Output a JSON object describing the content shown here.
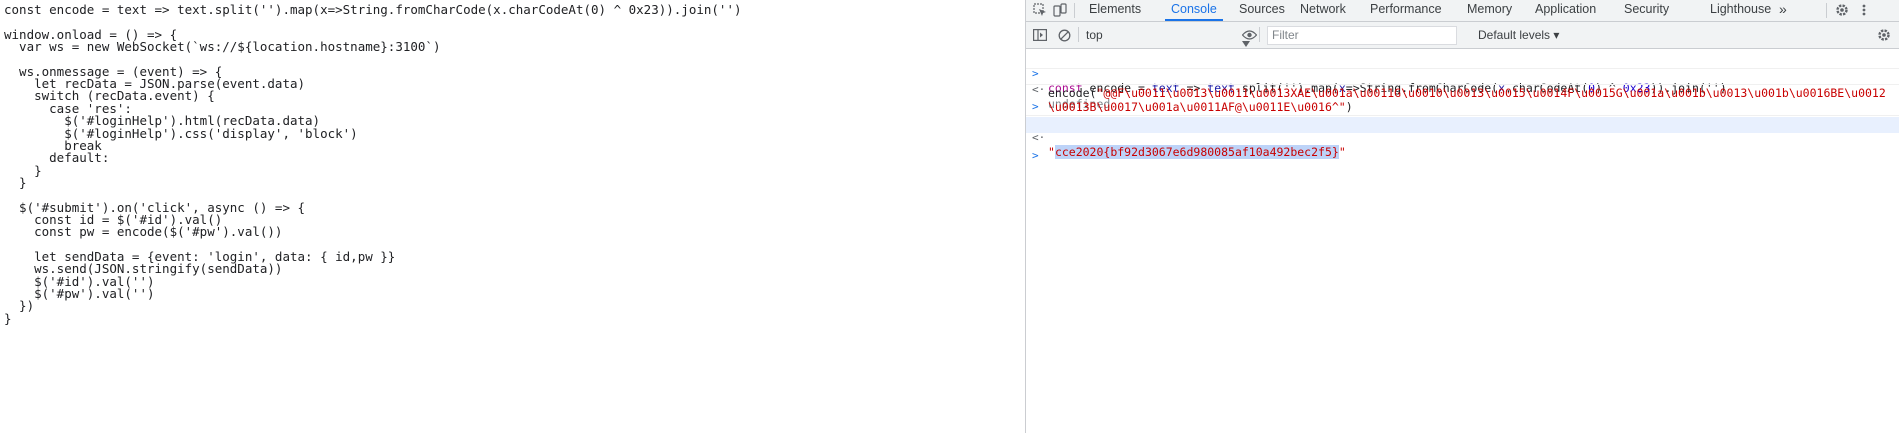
{
  "source": {
    "lines": [
      "const encode = text => text.split('').map(x=>String.fromCharCode(x.charCodeAt(0) ^ 0x23)).join('')",
      "",
      "window.onload = () => {",
      "  var ws = new WebSocket(`ws://${location.hostname}:3100`)",
      "",
      "  ws.onmessage = (event) => {",
      "    let recData = JSON.parse(event.data)",
      "    switch (recData.event) {",
      "      case 'res':",
      "        $('#loginHelp').html(recData.data)",
      "        $('#loginHelp').css('display', 'block')",
      "        break",
      "      default:",
      "    }",
      "  }",
      "",
      "  $('#submit').on('click', async () => {",
      "    const id = $('#id').val()",
      "    const pw = encode($('#pw').val())",
      "",
      "    let sendData = {event: 'login', data: { id,pw }}",
      "    ws.send(JSON.stringify(sendData))",
      "    $('#id').val('')",
      "    $('#pw').val('')",
      "  })",
      "}"
    ]
  },
  "devtools": {
    "tabs": [
      "Elements",
      "Console",
      "Sources",
      "Network",
      "Performance",
      "Memory",
      "Application",
      "Security",
      "Lighthouse"
    ],
    "active_tab": "Console",
    "more_tabs_glyph": "»",
    "toolbar": {
      "context": "top",
      "filter_placeholder": "Filter",
      "levels": "Default levels ▾"
    },
    "console": {
      "input1": {
        "prompt": ">",
        "p1": "const",
        "p2": " encode = ",
        "p3": "text",
        "p4": " => ",
        "p5": "text",
        "p6": ".split('').map(",
        "p7": "x",
        "p8": "=>String.fromCharCode(",
        "p9": "x",
        "p10": ".charCodeAt(",
        "p11": "0",
        "p12": ") ^ ",
        "p13": "0x23",
        "p14": ")).join('')"
      },
      "output1": {
        "prompt": "<·",
        "text": "undefined"
      },
      "input2": {
        "prompt": ">",
        "fn": "encode(",
        "arg_line1": "\"@@F\\u0011\\u0013\\u0011\\u0013XAE\\u001a\\u0011G\\u0010\\u0013\\u0015\\u0014F\\u0015G\\u001a\\u001b\\u0013\\u001b\\u0016BE\\u0012",
        "arg_line2": "\\u0013B\\u0017\\u001a\\u0011AF@\\u0011E\\u0016^\"",
        "close": ")"
      },
      "output2": {
        "prompt": "<·",
        "quote_open": "\"",
        "value": "cce2020{bf92d3067e6d980085af10a492bec2f5}",
        "quote_close": "\""
      },
      "prompt_empty": ">"
    }
  }
}
